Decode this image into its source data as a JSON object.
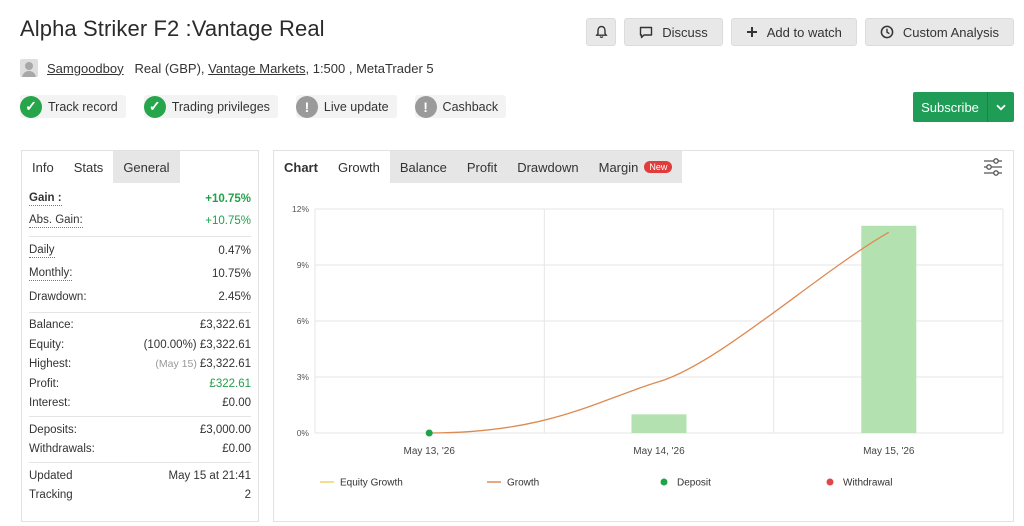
{
  "header": {
    "title": "Alpha Striker F2 :Vantage Real",
    "actions": {
      "bell": "bell-icon",
      "discuss": "Discuss",
      "add_to_watch": "Add to watch",
      "custom_analysis": "Custom Analysis"
    }
  },
  "account": {
    "user": "Samgoodboy",
    "type": "Real (GBP),",
    "broker": "Vantage Markets",
    "details": ", 1:500 , MetaTrader 5"
  },
  "badges": [
    {
      "label": "Track record",
      "status": "ok"
    },
    {
      "label": "Trading privileges",
      "status": "ok"
    },
    {
      "label": "Live update",
      "status": "warn"
    },
    {
      "label": "Cashback",
      "status": "warn"
    }
  ],
  "subscribe": {
    "label": "Subscribe"
  },
  "stats_tabs": [
    "Info",
    "Stats",
    "General"
  ],
  "stats": {
    "gain": {
      "label": "Gain :",
      "value": "+10.75%"
    },
    "abs_gain": {
      "label": "Abs. Gain:",
      "value": "+10.75%"
    },
    "daily": {
      "label": "Daily",
      "value": "0.47%"
    },
    "monthly": {
      "label": "Monthly:",
      "value": "10.75%"
    },
    "drawdown": {
      "label": "Drawdown:",
      "value": "2.45%"
    },
    "balance": {
      "label": "Balance:",
      "value": "£3,322.61"
    },
    "equity": {
      "label": "Equity:",
      "value": "(100.00%) £3,322.61"
    },
    "highest": {
      "label": "Highest:",
      "note": "(May 15)",
      "value": "£3,322.61"
    },
    "profit": {
      "label": "Profit:",
      "value": "£322.61"
    },
    "interest": {
      "label": "Interest:",
      "value": "£0.00"
    },
    "deposits": {
      "label": "Deposits:",
      "value": "£3,000.00"
    },
    "withdrawals": {
      "label": "Withdrawals:",
      "value": "£0.00"
    },
    "updated": {
      "label": "Updated",
      "value": "May 15 at 21:41"
    },
    "tracking": {
      "label": "Tracking",
      "value": "2"
    }
  },
  "chart_tabs": {
    "chart": "Chart",
    "growth": "Growth",
    "balance": "Balance",
    "profit": "Profit",
    "drawdown": "Drawdown",
    "margin": "Margin",
    "new": "New"
  },
  "colors": {
    "accent_green": "#1f9d57",
    "bar_fill": "#b3e2b0",
    "growth_line": "#dd8a52",
    "equity_line": "#f0d36b",
    "deposit": "#1fa34a",
    "withdrawal": "#e04848"
  },
  "chart_data": {
    "type": "bar",
    "x": [
      "May 13, '26",
      "May 14, '26",
      "May 15, '26"
    ],
    "ylim": [
      0,
      12
    ],
    "yticks": [
      "0%",
      "3%",
      "6%",
      "9%",
      "12%"
    ],
    "series": [
      {
        "name": "Growth",
        "kind": "bar",
        "values": [
          0,
          1.0,
          11.1
        ]
      },
      {
        "name": "Growth",
        "kind": "line",
        "values": [
          0,
          2.75,
          10.75
        ]
      },
      {
        "name": "Deposit",
        "kind": "marker",
        "values": [
          0,
          null,
          null
        ]
      }
    ],
    "legend": [
      "Equity Growth",
      "Growth",
      "Deposit",
      "Withdrawal"
    ],
    "legend_position": "bottom",
    "grid": true
  }
}
